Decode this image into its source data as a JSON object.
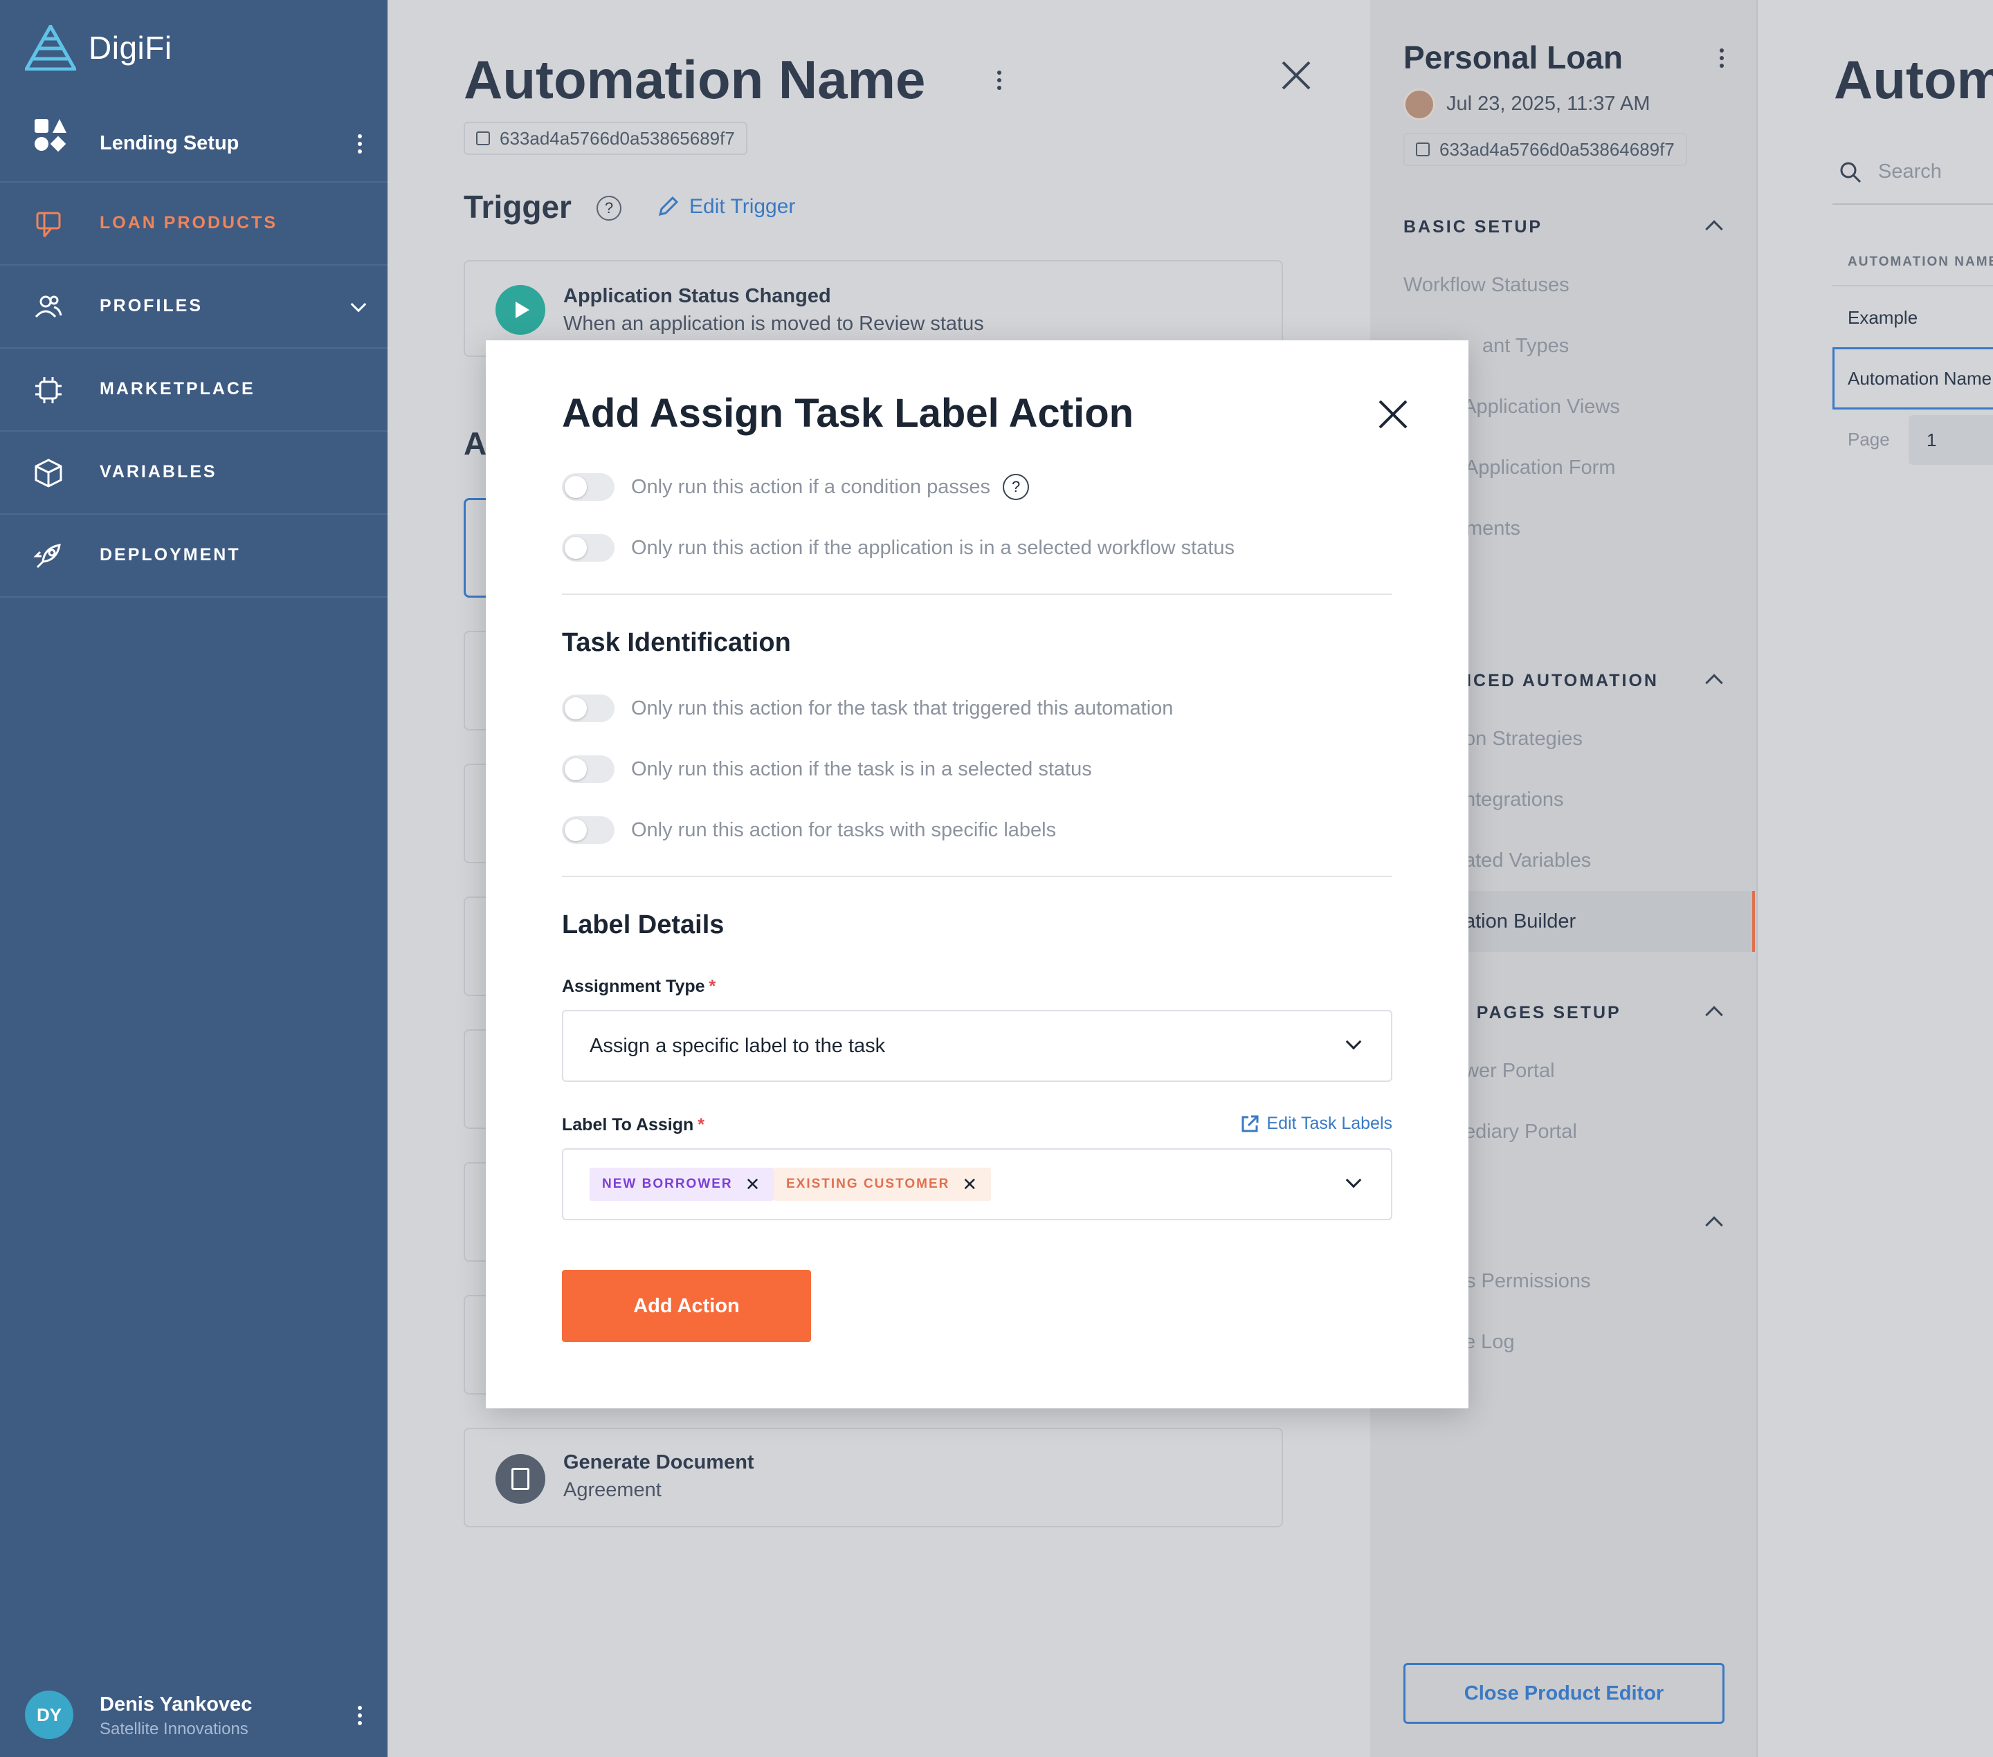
{
  "sidebar": {
    "logo_text": "DigiFi",
    "org_label": "Lending Setup",
    "nav": [
      {
        "label": "LOAN PRODUCTS",
        "icon": "loan-products-icon",
        "active": true
      },
      {
        "label": "PROFILES",
        "icon": "profiles-icon"
      },
      {
        "label": "MARKETPLACE",
        "icon": "marketplace-icon"
      },
      {
        "label": "VARIABLES",
        "icon": "cube-icon"
      },
      {
        "label": "DEPLOYMENT",
        "icon": "rocket-icon"
      }
    ],
    "user": {
      "initials": "DY",
      "name": "Denis Yankovec",
      "org": "Satellite Innovations"
    }
  },
  "editor": {
    "title": "Automation Name",
    "id": "633ad4a5766d0a53865689f7",
    "trigger_title": "Trigger",
    "edit_trigger": "Edit Trigger",
    "trigger_card": {
      "title": "Application Status Changed",
      "sub": "When an application is moved to Review status"
    },
    "actions_heading_partial": "A",
    "last_card": {
      "title": "Generate Document",
      "sub": "Agreement"
    }
  },
  "product": {
    "title": "Personal Loan",
    "date": "Jul 23, 2025, 11:37 AM",
    "id": "633ad4a5766d0a53864689f7",
    "sections": [
      {
        "head": "BASIC SETUP",
        "items": [
          "Workflow Statuses",
          "Applicant Types",
          "Application Views",
          "Application Form",
          "Documents"
        ]
      },
      {
        "head": "ADVANCED AUTOMATION",
        "items": [
          "Decision Strategies",
          "Integrations",
          "Calculated Variables",
          "Automation Builder"
        ]
      },
      {
        "head": "EXTERNAL PAGES SETUP",
        "items": [
          "Borrower Portal",
          "Intermediary Portal"
        ]
      },
      {
        "head": "",
        "items": [
          "Permissions",
          "Change Log"
        ]
      }
    ],
    "visible": {
      "basic_head": "BASIC SETUP",
      "basic_items": [
        "Workflow Statuses",
        "ant Types",
        "r Application Views",
        "l Application Form",
        "ments"
      ],
      "adv_head": "NCED AUTOMATION",
      "adv_items": [
        "on Strategies",
        "ntegrations",
        "ated Variables",
        "ation Builder"
      ],
      "ext_head": "L PAGES SETUP",
      "ext_items": [
        "wer Portal",
        "ediary Portal"
      ],
      "misc_head": "e",
      "misc_items": [
        "s Permissions",
        "e Log"
      ]
    },
    "close_button": "Close Product Editor"
  },
  "rightpane": {
    "title": "Autom",
    "search_placeholder": "Search",
    "col_head": "AUTOMATION NAME",
    "rows": [
      "Example",
      "Automation Name"
    ],
    "page_label": "Page",
    "page_value": "1"
  },
  "modal": {
    "title": "Add Assign Task Label Action",
    "toggles_top": [
      "Only run this action if a condition passes",
      "Only run this action if the application is in a selected workflow status"
    ],
    "task_section": "Task Identification",
    "toggles_task": [
      "Only run this action for the task that triggered this automation",
      "Only run this action if the task is in a selected status",
      "Only run this action for tasks with specific labels"
    ],
    "label_section": "Label Details",
    "assignment_type_label": "Assignment Type",
    "assignment_type_value": "Assign a specific label to the task",
    "label_to_assign": "Label To Assign",
    "edit_task_labels": "Edit Task Labels",
    "tags": [
      {
        "text": "NEW BORROWER",
        "color": "#7b3fd4"
      },
      {
        "text": "EXISTING CUSTOMER",
        "color": "#e0704e"
      }
    ],
    "required_mark": "*",
    "tag_remove": "✕",
    "add_button": "Add Action"
  },
  "colors": {
    "sidebar": "#3e5b82",
    "accent": "#f76b3a",
    "link": "#3a79c4",
    "active_nav": "#f0855a"
  }
}
